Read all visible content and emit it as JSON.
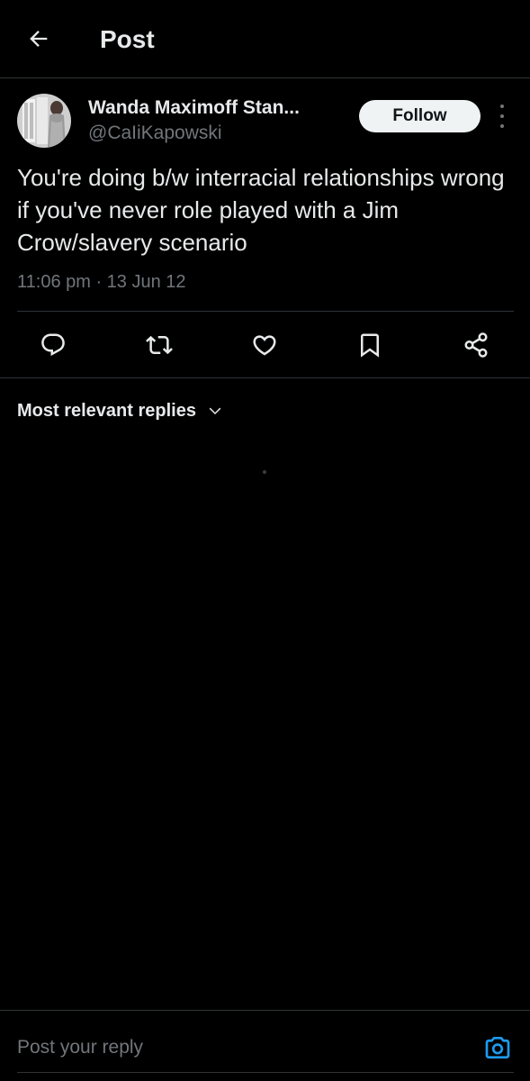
{
  "header": {
    "title": "Post",
    "back_icon": "arrow-left-icon"
  },
  "post": {
    "author_name": "Wanda Maximoff Stan...",
    "author_handle": "@CaIiKapowski",
    "follow_label": "Follow",
    "text": "You're doing b/w interracial relationships wrong if you've never role played with a Jim Crow/slavery scenario",
    "meta": "11:06 pm · 13 Jun 12"
  },
  "actions": [
    {
      "name": "reply",
      "icon": "comment-icon"
    },
    {
      "name": "repost",
      "icon": "repost-icon"
    },
    {
      "name": "like",
      "icon": "heart-icon"
    },
    {
      "name": "bookmark",
      "icon": "bookmark-icon"
    },
    {
      "name": "share",
      "icon": "share-icon"
    }
  ],
  "replies": {
    "sort_label": "Most relevant replies"
  },
  "composer": {
    "placeholder": "Post your reply",
    "camera_icon": "camera-icon"
  },
  "colors": {
    "background": "#000000",
    "text_primary": "#e7e9ea",
    "text_secondary": "#71767b",
    "border": "#2f3336",
    "accent": "#1d9bf0",
    "follow_bg": "#eff3f4"
  }
}
